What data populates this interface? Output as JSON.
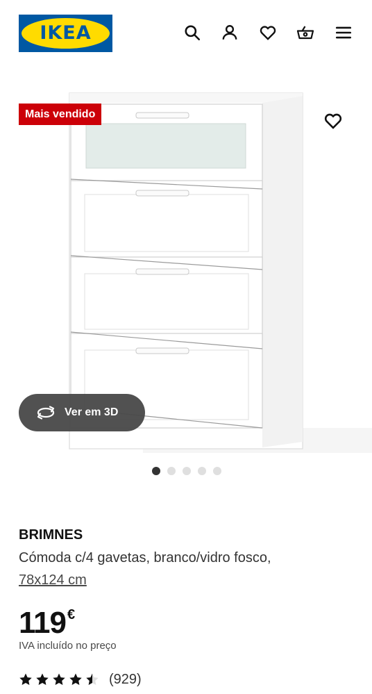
{
  "header": {
    "logo_text": "IKEA",
    "icons": [
      "search-icon",
      "account-icon",
      "heart-icon",
      "cart-icon",
      "menu-icon"
    ]
  },
  "media": {
    "badge": "Mais vendido",
    "view_3d_label": "Ver em 3D",
    "carousel_count": 5,
    "carousel_active": 0
  },
  "product": {
    "name": "BRIMNES",
    "description": "Cómoda c/4 gavetas, branco/vidro fosco,",
    "size": "78x124 cm",
    "price_integer": "119",
    "currency": "€",
    "vat_note": "IVA incluído no preço",
    "rating_value": 4.5,
    "rating_count": "(929)"
  },
  "colors": {
    "logo_blue": "#0058a3",
    "logo_yellow": "#ffdb00",
    "badge_red": "#cc0008"
  }
}
